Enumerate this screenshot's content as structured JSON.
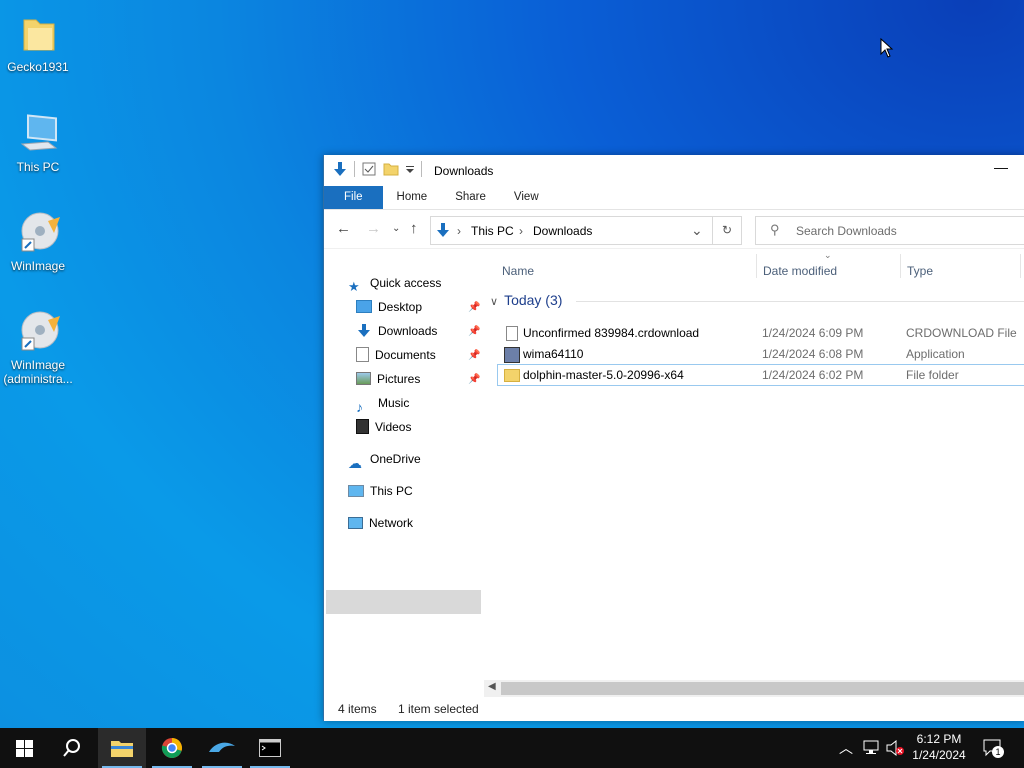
{
  "desktop": {
    "icons": [
      {
        "label": "Gecko1931",
        "icon": "folder-icon"
      },
      {
        "label": "This PC",
        "icon": "computer-icon"
      },
      {
        "label": "WinImage",
        "icon": "disc-shortcut-icon"
      },
      {
        "label": "WinImage (administra...",
        "icon": "disc-shortcut-icon"
      }
    ]
  },
  "explorer": {
    "title": "Downloads",
    "ribbon_tabs": [
      "File",
      "Home",
      "Share",
      "View"
    ],
    "address": {
      "crumbs": [
        "This PC",
        "Downloads"
      ]
    },
    "search": {
      "placeholder": "Search Downloads"
    },
    "nav_pane": {
      "quick_access": "Quick access",
      "items": [
        "Desktop",
        "Downloads",
        "Documents",
        "Pictures",
        "Music",
        "Videos"
      ],
      "onedrive": "OneDrive",
      "this_pc": "This PC",
      "network": "Network"
    },
    "columns": [
      "Name",
      "Date modified",
      "Type"
    ],
    "group": "Today (3)",
    "files": [
      {
        "name": "Unconfirmed 839984.crdownload",
        "date": "1/24/2024 6:09 PM",
        "type": "CRDOWNLOAD File",
        "icon": "file-icon"
      },
      {
        "name": "wima64110",
        "date": "1/24/2024 6:08 PM",
        "type": "Application",
        "icon": "installer-icon"
      },
      {
        "name": "dolphin-master-5.0-20996-x64",
        "date": "1/24/2024 6:02 PM",
        "type": "File folder",
        "icon": "folder-icon"
      }
    ],
    "status": {
      "items": "4 items",
      "selected": "1 item selected"
    }
  },
  "taskbar": {
    "time": "6:12 PM",
    "date": "1/24/2024",
    "notification_count": "1"
  },
  "colors": {
    "accent": "#1a6fbf",
    "taskbar": "#101010"
  }
}
